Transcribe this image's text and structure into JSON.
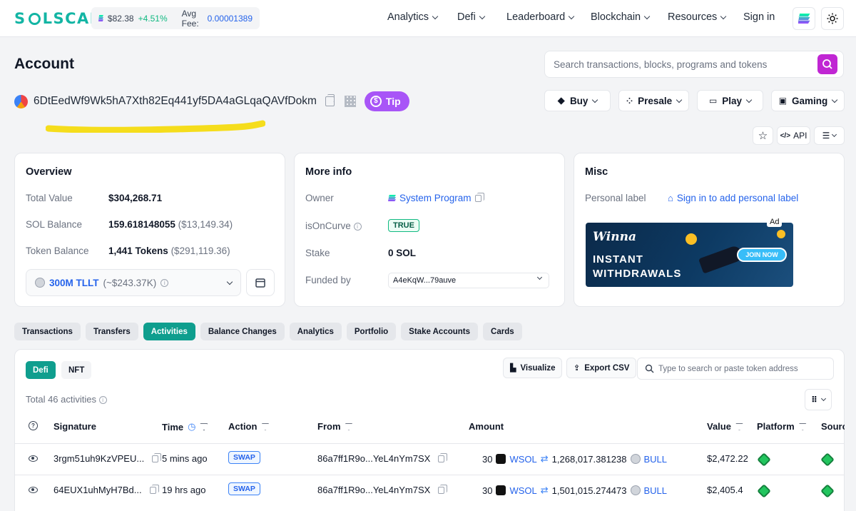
{
  "header": {
    "logo": "SOLSCAN",
    "sol_price": "$82.38",
    "sol_change": "+4.51%",
    "avg_fee_label": "Avg Fee:",
    "avg_fee_value": "0.00001389",
    "nav": [
      "Analytics",
      "Defi",
      "Leaderboard",
      "Blockchain",
      "Resources"
    ],
    "sign_in": "Sign in"
  },
  "page": {
    "title": "Account",
    "search_placeholder": "Search transactions, blocks, programs and tokens",
    "address": "6DtEedWf9Wk5hA7Xth82Eq441yf5DA4aGLqaQAVfDokm",
    "tip_label": "Tip",
    "highlight_color": "#f5dd1c",
    "action_buttons": [
      "Buy",
      "Presale",
      "Play",
      "Gaming"
    ],
    "api_label": "API"
  },
  "overview": {
    "title": "Overview",
    "total_value_label": "Total Value",
    "total_value": "$304,268.71",
    "sol_balance_label": "SOL Balance",
    "sol_balance": "159.618148055",
    "sol_balance_usd": "($13,149.34)",
    "token_balance_label": "Token Balance",
    "token_balance": "1,441 Tokens",
    "token_balance_usd": "($291,119.36)",
    "token_select": "300M TLLT",
    "token_select_value": "(~$243.37K)"
  },
  "more_info": {
    "title": "More info",
    "owner_label": "Owner",
    "owner_value": "System Program",
    "oncurve_label": "isOnCurve",
    "oncurve_value": "TRUE",
    "stake_label": "Stake",
    "stake_value": "0 SOL",
    "funded_label": "Funded by",
    "funded_value": "A4eKqW...79auve"
  },
  "misc": {
    "title": "Misc",
    "personal_label": "Personal label",
    "personal_link": "Sign in to add personal label",
    "ad_tag": "Ad",
    "ad_brand": "Winna",
    "ad_text_1": "INSTANT",
    "ad_text_2": "WITHDRAWALS",
    "ad_button": "JOIN NOW"
  },
  "tabs": [
    "Transactions",
    "Transfers",
    "Activities",
    "Balance Changes",
    "Analytics",
    "Portfolio",
    "Stake Accounts",
    "Cards"
  ],
  "activities": {
    "sub_tabs": [
      "Defi",
      "NFT"
    ],
    "visualize": "Visualize",
    "export": "Export CSV",
    "token_search_placeholder": "Type to search or paste token address",
    "total": "Total 46 activities",
    "columns": [
      "Signature",
      "Time",
      "Action",
      "From",
      "Amount",
      "Value",
      "Platform",
      "Source"
    ],
    "rows": [
      {
        "signature": "3rgm51uh9KzVPEU...",
        "time": "5 mins ago",
        "action": "SWAP",
        "from": "86a7ff1R9o...YeL4nYm7SX",
        "amount_in": "30",
        "token_in": "WSOL",
        "amount_out": "1,268,017.381238",
        "token_out": "BULL",
        "value": "$2,472.22"
      },
      {
        "signature": "64EUX1uhMyH7Bd...",
        "time": "19 hrs ago",
        "action": "SWAP",
        "from": "86a7ff1R9o...YeL4nYm7SX",
        "amount_in": "30",
        "token_in": "WSOL",
        "amount_out": "1,501,015.274473",
        "token_out": "BULL",
        "value": "$2,405.4"
      }
    ]
  }
}
